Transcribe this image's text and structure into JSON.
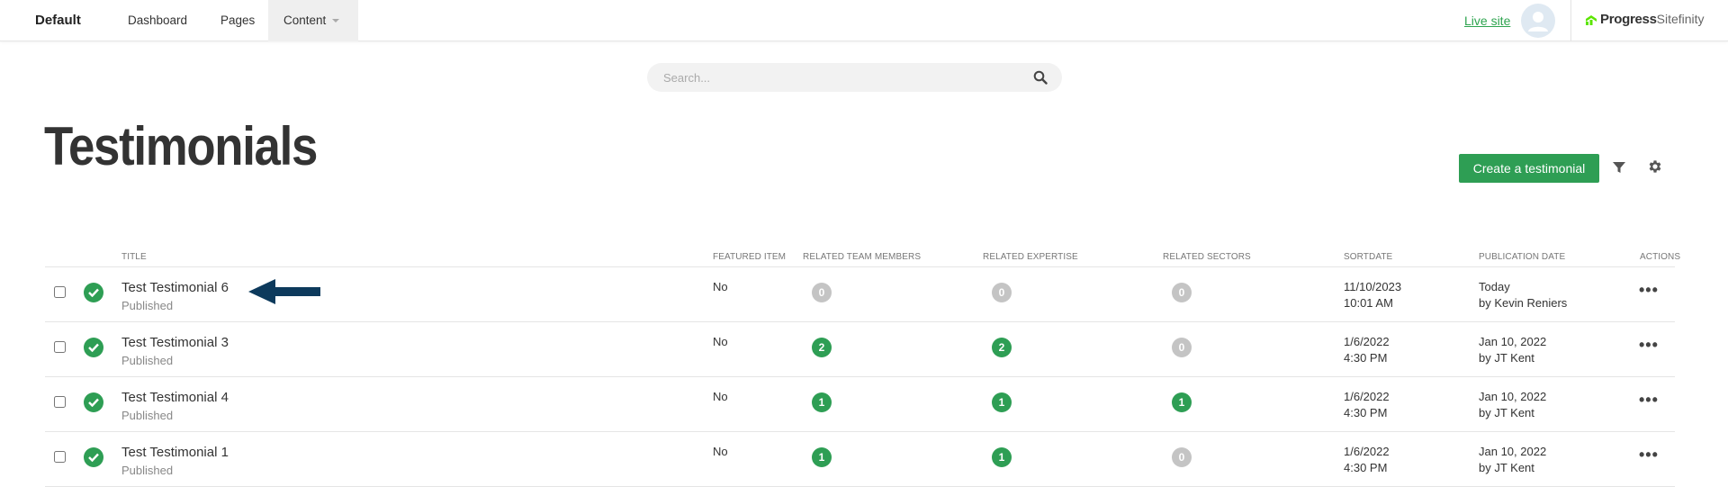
{
  "topbar": {
    "site_name": "Default",
    "nav": [
      {
        "label": "Dashboard"
      },
      {
        "label": "Pages"
      },
      {
        "label": "Content"
      }
    ],
    "live_site": "Live site",
    "brand_primary": "Progress",
    "brand_secondary": "Sitefinity"
  },
  "search": {
    "placeholder": "Search..."
  },
  "page": {
    "title": "Testimonials",
    "create_button": "Create a testimonial"
  },
  "table": {
    "columns": [
      "Title",
      "Featured item",
      "Related team members",
      "Related expertise",
      "Related sectors",
      "SortDate",
      "Publication date",
      "Actions"
    ],
    "rows": [
      {
        "title": "Test Testimonial 6",
        "status": "Published",
        "featured": "No",
        "team": "0",
        "expertise": "0",
        "sectors": "0",
        "sort_date": "11/10/2023",
        "sort_time": "10:01 AM",
        "pub_date": "Today",
        "pub_by": "by Kevin Reniers",
        "actions": "•••"
      },
      {
        "title": "Test Testimonial 3",
        "status": "Published",
        "featured": "No",
        "team": "2",
        "expertise": "2",
        "sectors": "0",
        "sort_date": "1/6/2022",
        "sort_time": "4:30 PM",
        "pub_date": "Jan 10, 2022",
        "pub_by": "by JT Kent",
        "actions": "•••"
      },
      {
        "title": "Test Testimonial 4",
        "status": "Published",
        "featured": "No",
        "team": "1",
        "expertise": "1",
        "sectors": "1",
        "sort_date": "1/6/2022",
        "sort_time": "4:30 PM",
        "pub_date": "Jan 10, 2022",
        "pub_by": "by JT Kent",
        "actions": "•••"
      },
      {
        "title": "Test Testimonial 1",
        "status": "Published",
        "featured": "No",
        "team": "1",
        "expertise": "1",
        "sectors": "0",
        "sort_date": "1/6/2022",
        "sort_time": "4:30 PM",
        "pub_date": "Jan 10, 2022",
        "pub_by": "by JT Kent",
        "actions": "•••"
      }
    ]
  },
  "colors": {
    "accent_green": "#2e9e54",
    "badge_zero": "#c4c4c4",
    "arrow": "#0d3a5c"
  }
}
